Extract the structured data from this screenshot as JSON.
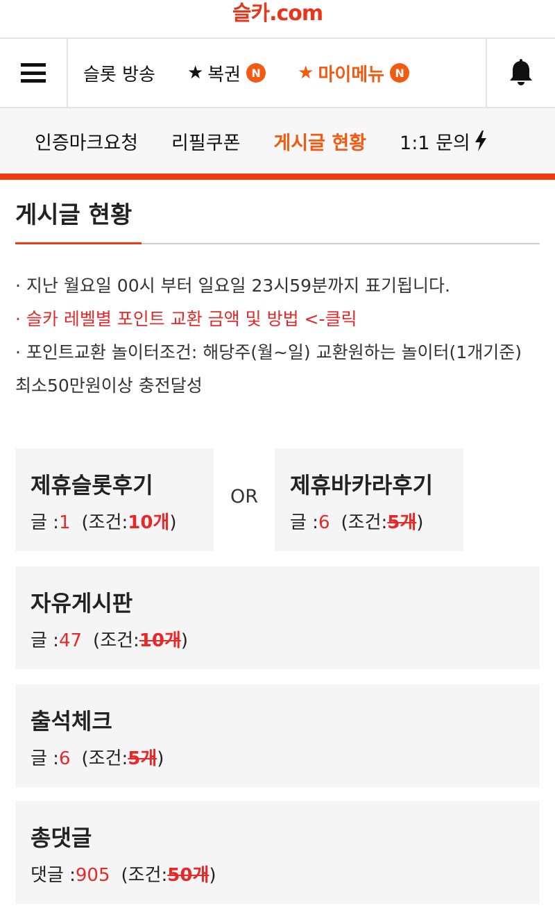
{
  "logo": "슬카.com",
  "top_nav": {
    "items": [
      {
        "label": "슬롯 방송",
        "star": "",
        "badge": ""
      },
      {
        "label": "복권",
        "star": "★",
        "badge": "N"
      },
      {
        "label": "마이메뉴",
        "star": "★",
        "badge": "N"
      }
    ],
    "icons": {
      "menu": "hamburger-icon",
      "alert": "bell-icon"
    }
  },
  "sub_nav": {
    "items": [
      "인증마크요청",
      "리필쿠폰",
      "게시글 현황",
      "1:1 문의"
    ],
    "active": "게시글 현황"
  },
  "page": {
    "title": "게시글 현황",
    "notes": [
      "· 지난 월요일 00시 부터 일요일 23시59분까지 표기됩니다.",
      "· 슬카 레벨별 포인트 교환 금액 및 방법 <-클릭",
      "· 포인트교환 놀이터조건: 해당주(월~일) 교환원하는 놀이터(1개기준) 최소50만원이상 충전달성"
    ],
    "or_label": "OR",
    "cards": [
      {
        "title": "제휴슬롯후기",
        "count_label": "글 :",
        "count": "1",
        "cond_prefix": "(조건:",
        "cond_value": "10개",
        "cond_suffix": ")",
        "met": false
      },
      {
        "title": "제휴바카라후기",
        "count_label": "글 :",
        "count": "6",
        "cond_prefix": "(조건:",
        "cond_value": "5개",
        "cond_suffix": ")",
        "met": true
      },
      {
        "title": "자유게시판",
        "count_label": "글 :",
        "count": "47",
        "cond_prefix": "(조건:",
        "cond_value": "10개",
        "cond_suffix": ")",
        "met": true
      },
      {
        "title": "출석체크",
        "count_label": "글 :",
        "count": "6",
        "cond_prefix": "(조건:",
        "cond_value": "5개",
        "cond_suffix": ")",
        "met": true
      },
      {
        "title": "총댓글",
        "count_label": "댓글 :",
        "count": "905",
        "cond_prefix": "(조건:",
        "cond_value": "50개",
        "cond_suffix": ")",
        "met": true
      }
    ]
  },
  "colors": {
    "accent": "#f35a10",
    "red": "#e82828",
    "line": "#f23a0e"
  }
}
